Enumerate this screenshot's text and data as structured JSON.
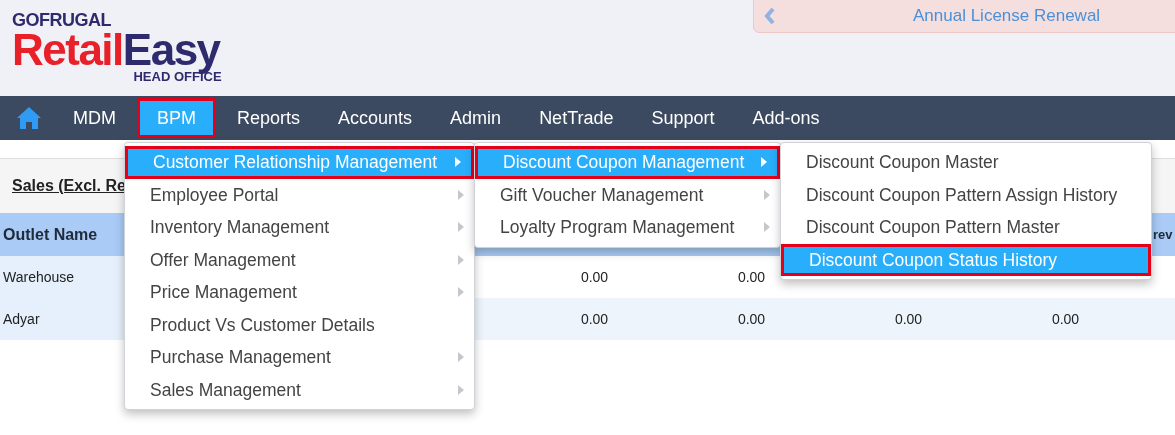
{
  "logo": {
    "brand": "GOFRUGAL",
    "product_part_1": "Retail",
    "product_part_2": "Easy",
    "edition": "HEAD OFFICE"
  },
  "banner": {
    "text": "Annual License Renewal"
  },
  "nav": [
    {
      "label": "MDM",
      "selected": false
    },
    {
      "label": "BPM",
      "selected": true
    },
    {
      "label": "Reports",
      "selected": false
    },
    {
      "label": "Accounts",
      "selected": false
    },
    {
      "label": "Admin",
      "selected": false
    },
    {
      "label": "NetTrade",
      "selected": false
    },
    {
      "label": "Support",
      "selected": false
    },
    {
      "label": "Add-ons",
      "selected": false
    }
  ],
  "report": {
    "title": "Sales (Excl. Re",
    "columns": {
      "column_1": "Outlet Name",
      "column_6": "rev"
    },
    "rows": [
      {
        "outlet": "Warehouse",
        "values": [
          "0.00",
          "0.00"
        ]
      },
      {
        "outlet": "Adyar",
        "values": [
          "0.00",
          "0.00",
          "0.00",
          "0.00"
        ]
      }
    ]
  },
  "menus": [
    [
      {
        "label": "Customer Relationship Management",
        "submenu": true,
        "selected": true
      },
      {
        "label": "Employee Portal",
        "submenu": true,
        "selected": false
      },
      {
        "label": "Inventory Management",
        "submenu": true,
        "selected": false
      },
      {
        "label": "Offer Management",
        "submenu": true,
        "selected": false
      },
      {
        "label": "Price Management",
        "submenu": true,
        "selected": false
      },
      {
        "label": "Product Vs Customer Details",
        "submenu": false,
        "selected": false
      },
      {
        "label": "Purchase Management",
        "submenu": true,
        "selected": false
      },
      {
        "label": "Sales Management",
        "submenu": true,
        "selected": false
      }
    ],
    [
      {
        "label": "Discount Coupon Management",
        "submenu": true,
        "selected": true
      },
      {
        "label": "Gift Voucher Management",
        "submenu": true,
        "selected": false
      },
      {
        "label": "Loyalty Program Management",
        "submenu": true,
        "selected": false
      }
    ],
    [
      {
        "label": "Discount Coupon Master",
        "submenu": false,
        "selected": false
      },
      {
        "label": "Discount Coupon Pattern Assign History",
        "submenu": false,
        "selected": false
      },
      {
        "label": "Discount Coupon Pattern Master",
        "submenu": false,
        "selected": false
      },
      {
        "label": "Discount Coupon Status History",
        "submenu": false,
        "selected": true
      }
    ]
  ]
}
